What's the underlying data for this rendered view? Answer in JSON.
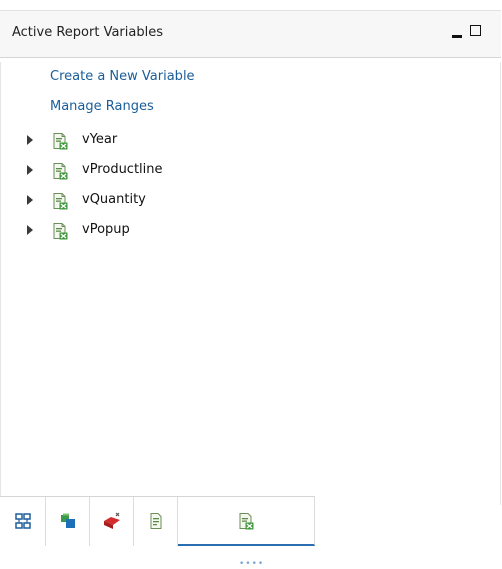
{
  "panel": {
    "title": "Active Report Variables",
    "controls": {
      "minimize_icon": "minimize-icon",
      "maximize_icon": "maximize-icon"
    }
  },
  "links": {
    "create_variable": "Create a New Variable",
    "manage_ranges": "Manage Ranges"
  },
  "variables": [
    {
      "name": "vYear",
      "icon": "variable-icon",
      "expanded": false
    },
    {
      "name": "vProductline",
      "icon": "variable-icon",
      "expanded": false
    },
    {
      "name": "vQuantity",
      "icon": "variable-icon",
      "expanded": false
    },
    {
      "name": "vPopup",
      "icon": "variable-icon",
      "expanded": false
    }
  ],
  "tabs": [
    {
      "icon": "structure-tree-icon",
      "active": false
    },
    {
      "icon": "data-cubes-icon",
      "active": false
    },
    {
      "icon": "delete-item-icon",
      "active": false
    },
    {
      "icon": "report-page-icon",
      "active": false
    },
    {
      "icon": "report-variables-icon",
      "active": true
    }
  ],
  "colors": {
    "link": "#1a5d9a",
    "active_tab_underline": "#2a6db0",
    "header_background": "#f7f7f7"
  }
}
